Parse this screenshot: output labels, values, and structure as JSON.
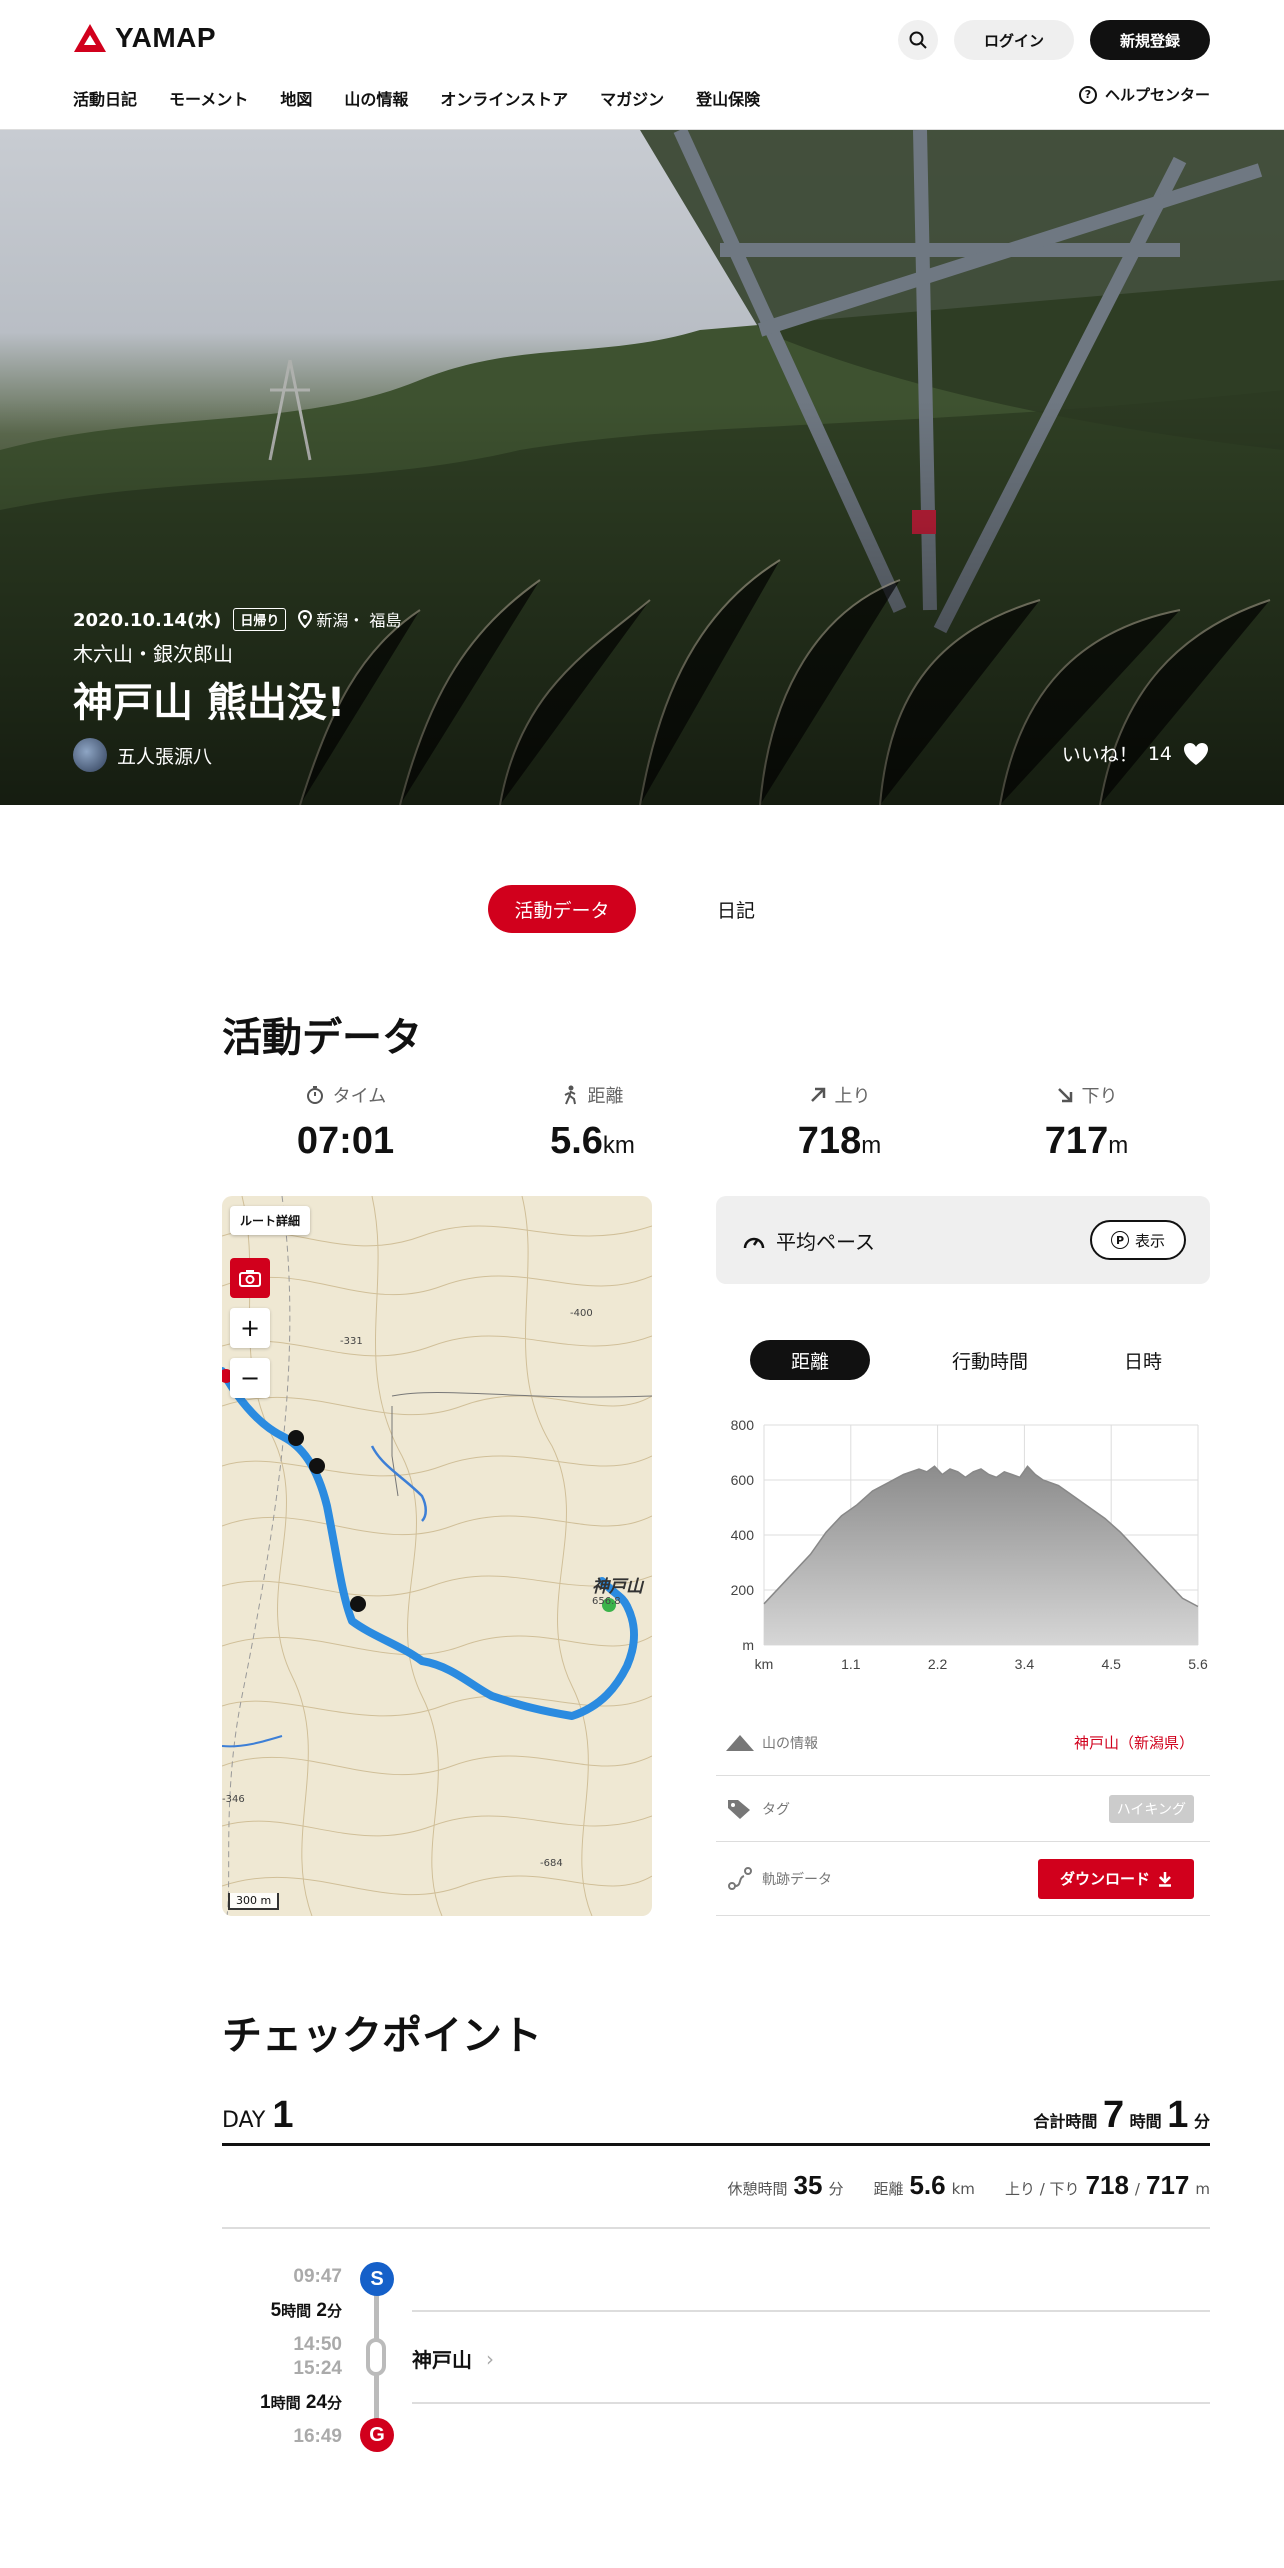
{
  "brand": {
    "logo_text": "YAMAP",
    "accent": "#d1001c"
  },
  "header": {
    "login": "ログイン",
    "signup": "新規登録",
    "help": "ヘルプセンター",
    "nav": [
      "活動日記",
      "モーメント",
      "地図",
      "山の情報",
      "オンラインストア",
      "マガジン",
      "登山保険"
    ]
  },
  "hero": {
    "date": "2020.10.14(水)",
    "tag": "日帰り",
    "location": "新潟・ 福島",
    "area": "木六山・銀次郎山",
    "title": "神戸山 熊出没!",
    "user": "五人張源八",
    "like_label": "いいね！",
    "like_count": "14"
  },
  "tabs": {
    "active": "活動データ",
    "other": "日記"
  },
  "activity": {
    "title": "活動データ",
    "stats": [
      {
        "icon": "stopwatch-icon",
        "label": "タイム",
        "value": "07:01",
        "unit": ""
      },
      {
        "icon": "walker-icon",
        "label": "距離",
        "value": "5.6",
        "unit": "km"
      },
      {
        "icon": "arrow-up-right-icon",
        "label": "上り",
        "value": "718",
        "unit": "m"
      },
      {
        "icon": "arrow-down-right-icon",
        "label": "下り",
        "value": "717",
        "unit": "m"
      }
    ]
  },
  "map": {
    "route_detail": "ルート詳細",
    "zoom_in": "+",
    "zoom_out": "−",
    "peak": "神戸山",
    "peak_elev": "656.8",
    "elev_labels": [
      "-400",
      "-331",
      "-346",
      "-684"
    ],
    "scale": "300 m"
  },
  "pace": {
    "label": "平均ペース",
    "button": "表示",
    "p": "P"
  },
  "chart_tabs": [
    "距離",
    "行動時間",
    "日時"
  ],
  "chart_data": {
    "type": "area",
    "xlabel": "km",
    "ylabel": "m",
    "x_ticks": [
      "km",
      "1.1",
      "2.2",
      "3.4",
      "4.5",
      "5.6"
    ],
    "y_ticks": [
      "800",
      "600",
      "400",
      "200",
      "m"
    ],
    "ylim": [
      0,
      800
    ],
    "xlim": [
      0,
      5.6
    ],
    "x": [
      0,
      0.2,
      0.4,
      0.6,
      0.8,
      1.0,
      1.2,
      1.4,
      1.6,
      1.8,
      2.0,
      2.1,
      2.2,
      2.3,
      2.4,
      2.5,
      2.6,
      2.7,
      2.8,
      2.9,
      3.0,
      3.1,
      3.2,
      3.3,
      3.4,
      3.5,
      3.6,
      3.8,
      4.0,
      4.2,
      4.4,
      4.6,
      4.8,
      5.0,
      5.2,
      5.4,
      5.6
    ],
    "values": [
      150,
      210,
      270,
      330,
      410,
      470,
      510,
      560,
      590,
      620,
      640,
      630,
      650,
      620,
      640,
      630,
      610,
      630,
      640,
      620,
      610,
      630,
      620,
      610,
      650,
      620,
      600,
      580,
      540,
      500,
      460,
      410,
      350,
      290,
      230,
      170,
      140
    ],
    "grid": true
  },
  "info": {
    "mountain_label": "山の情報",
    "mountain_value": "神戸山（新潟県）",
    "tag_label": "タグ",
    "tag_value": "ハイキング",
    "track_label": "軌跡データ",
    "download": "ダウンロード"
  },
  "checkpoint": {
    "title": "チェックポイント",
    "day_label": "DAY",
    "day_num": "1",
    "total_label": "合計時間",
    "total_h": "7",
    "h_unit": "時間",
    "total_m": "1",
    "m_unit": "分",
    "rest_label": "休憩時間",
    "rest_val": "35",
    "rest_unit": "分",
    "dist_label": "距離",
    "dist_val": "5.6",
    "dist_unit": "km",
    "updown_label": "上り / 下り",
    "up_val": "718",
    "slash": "/",
    "down_val": "717",
    "updown_unit": "m",
    "start_time": "09:47",
    "dur1_h": "5",
    "dur1_hu": "時間",
    "dur1_m": "2",
    "dur1_mu": "分",
    "mid_time1": "14:50",
    "mid_time2": "15:24",
    "dur2_h": "1",
    "dur2_hu": "時間",
    "dur2_m": "24",
    "dur2_mu": "分",
    "end_time": "16:49",
    "start_mark": "S",
    "goal_mark": "G",
    "point_name": "神戸山"
  }
}
